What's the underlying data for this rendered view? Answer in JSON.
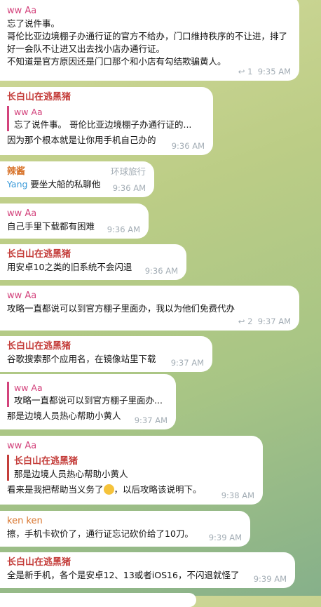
{
  "messages": [
    {
      "sender": "ww Aa",
      "lines": [
        "忘了说件事。",
        "哥伦比亚边境棚子办通行证的官方不给办，门口维持秩序的不让进，排了好一会队不让进又出去找小店办通行证。",
        "不知道是官方原因还是门口那个和小店有勾结欺骗黄人。"
      ],
      "replies": "1",
      "time": "9:35 AM"
    },
    {
      "sender": "长白山在逃黑猪",
      "quote_sender": "ww Aa",
      "quote_text": "忘了说件事。 哥伦比亚边境棚子办通行证的...",
      "text": "因为那个根本就是让你用手机自己办的",
      "time": "9:36 AM"
    },
    {
      "sender": "辣酱",
      "tag": "环球旅行",
      "mention": "Yang",
      "text": "要坐大船的私聊他",
      "time": "9:36 AM"
    },
    {
      "sender": "ww Aa",
      "text": "自己手里下载都有困难",
      "time": "9:36 AM"
    },
    {
      "sender": "长白山在逃黑猪",
      "text": "用安卓10之类的旧系统不会闪退",
      "time": "9:36 AM"
    },
    {
      "sender": "ww Aa",
      "text": "攻略一直都说可以到官方棚子里面办，我以为他们免费代办",
      "replies": "2",
      "time": "9:37 AM"
    },
    {
      "sender": "长白山在逃黑猪",
      "text": "谷歌搜索那个应用名，在镜像站里下载",
      "time": "9:37 AM"
    },
    {
      "quote_sender": "ww Aa",
      "quote_text": "攻略一直都说可以到官方棚子里面办...",
      "text": "那是边境人员热心帮助小黄人",
      "time": "9:37 AM"
    },
    {
      "sender": "ww Aa",
      "quote_sender": "长白山在逃黑猪",
      "quote_text": "那是边境人员热心帮助小黄人",
      "text_before": "看来是我把帮助当义务了",
      "emoji": "crying-face",
      "text_after": "，以后攻略该说明下。",
      "time": "9:38 AM"
    },
    {
      "sender": "ken ken",
      "text": "擦，手机卡砍价了，通行证忘记砍价给了10刀。",
      "time": "9:39 AM"
    },
    {
      "sender": "长白山在逃黑猪",
      "text": "全是新手机，各个是安卓12、13或者iOS16，不闪退就怪了",
      "time": "9:39 AM"
    }
  ],
  "colors": {
    "ww": "#d3437c",
    "pig": "#c43d3a",
    "orange": "#d8742c",
    "mention": "#3a9ad9"
  }
}
